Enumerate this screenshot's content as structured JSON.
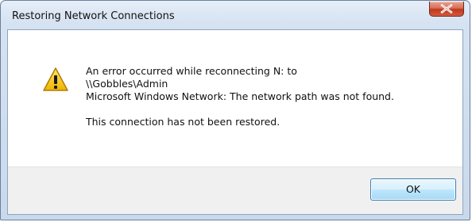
{
  "window": {
    "title": "Restoring Network Connections"
  },
  "titlebar": {
    "close_icon": "close-icon"
  },
  "dialog": {
    "icon": "warning-icon",
    "message_lines": [
      "An error occurred while reconnecting N: to",
      "\\\\Gobbles\\Admin",
      "Microsoft Windows Network: The network path was not found.",
      "This connection has not been restored."
    ]
  },
  "buttons": {
    "ok_label": "OK"
  },
  "colors": {
    "titlebar": "#d5e2f1",
    "close_button": "#c1381d",
    "warning": "#f2c811",
    "footer": "#f0f0f0",
    "ok_border": "#3c7fb1"
  }
}
